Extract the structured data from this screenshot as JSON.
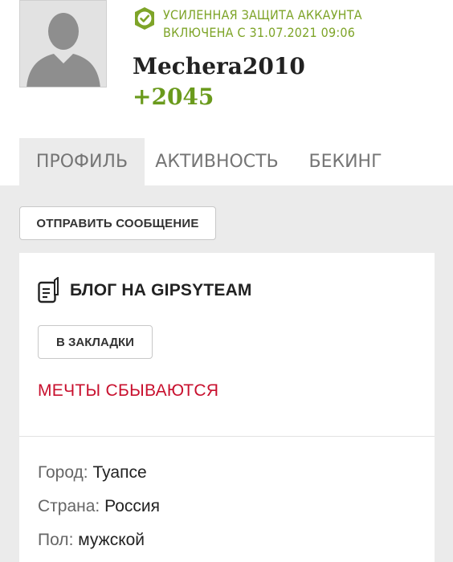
{
  "profile": {
    "security_line1": "УСИЛЕННАЯ ЗАЩИТА АККАУНТА",
    "security_line2": "ВКЛЮЧЕНА С 31.07.2021  09:06",
    "username": "Mechera2010",
    "rating": "+2045",
    "accent_color": "#7ea428"
  },
  "tabs": [
    {
      "label": "ПРОФИЛЬ",
      "active": true
    },
    {
      "label": "АКТИВНОСТЬ",
      "active": false
    },
    {
      "label": "БЕКИНГ",
      "active": false
    }
  ],
  "actions": {
    "send_message": "ОТПРАВИТЬ СООБЩЕНИЕ"
  },
  "blog": {
    "title": "БЛОГ НА GIPSYTEAM",
    "bookmark_label": "В ЗАКЛАДКИ",
    "motto": "МЕЧТЫ СБЫВАЮТСЯ",
    "motto_color": "#c8102e"
  },
  "info": {
    "city_label": "Город:",
    "city_value": "Туапсе",
    "country_label": "Страна:",
    "country_value": "Россия",
    "gender_label": "Пол:",
    "gender_value": "мужской"
  }
}
